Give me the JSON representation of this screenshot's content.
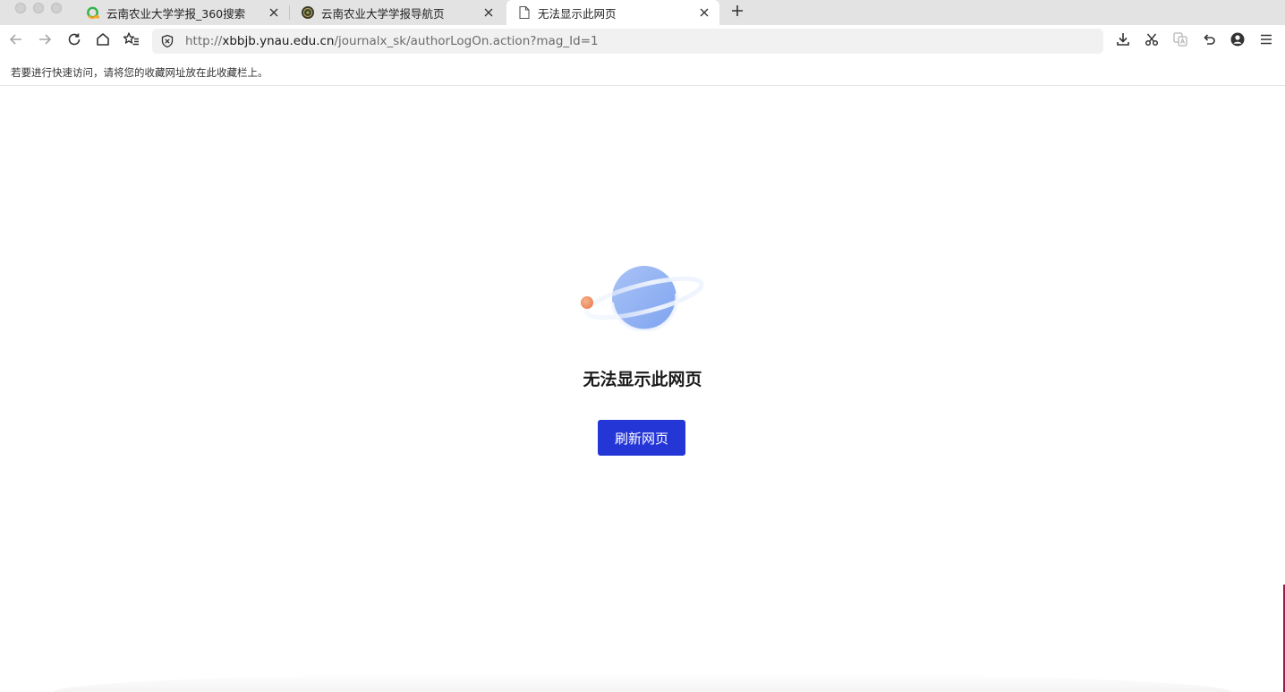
{
  "tabs": [
    {
      "title": "云南农业大学学报_360搜索",
      "favicon": "360-search-icon",
      "active": false
    },
    {
      "title": "云南农业大学学报导航页",
      "favicon": "site-logo-icon",
      "active": false
    },
    {
      "title": "无法显示此网页",
      "favicon": "page-icon",
      "active": true
    }
  ],
  "address_bar": {
    "scheme": "http://",
    "host": "xbbjb.ynau.edu.cn",
    "path": "/journalx_sk/authorLogOn.action?mag_Id=1"
  },
  "bookmarks_bar": {
    "hint": "若要进行快速访问，请将您的收藏网址放在此收藏栏上。"
  },
  "error_page": {
    "title": "无法显示此网页",
    "refresh_label": "刷新网页",
    "illustration": "planet-icon"
  },
  "colors": {
    "accent": "#2536d6",
    "tab_strip": "#e3e3e3",
    "planet": "#8fb0f2",
    "moon": "#f0956a"
  }
}
